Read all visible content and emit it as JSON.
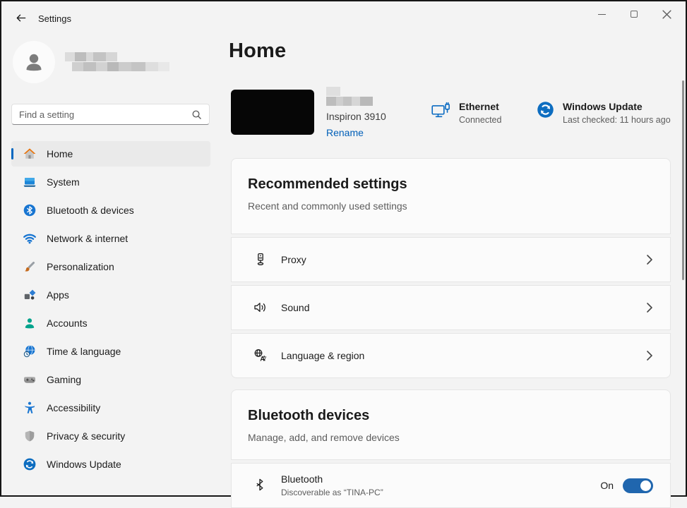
{
  "titlebar": {
    "title": "Settings"
  },
  "search": {
    "placeholder": "Find a setting"
  },
  "sidebar": {
    "items": [
      {
        "label": "Home",
        "icon": "home-icon",
        "selected": true
      },
      {
        "label": "System",
        "icon": "system-icon"
      },
      {
        "label": "Bluetooth & devices",
        "icon": "bluetooth-icon"
      },
      {
        "label": "Network & internet",
        "icon": "network-icon"
      },
      {
        "label": "Personalization",
        "icon": "personalization-icon"
      },
      {
        "label": "Apps",
        "icon": "apps-icon"
      },
      {
        "label": "Accounts",
        "icon": "accounts-icon"
      },
      {
        "label": "Time & language",
        "icon": "time-language-icon"
      },
      {
        "label": "Gaming",
        "icon": "gaming-icon"
      },
      {
        "label": "Accessibility",
        "icon": "accessibility-icon"
      },
      {
        "label": "Privacy & security",
        "icon": "privacy-icon"
      },
      {
        "label": "Windows Update",
        "icon": "windows-update-icon"
      }
    ]
  },
  "main": {
    "page_title": "Home",
    "device": {
      "model": "Inspiron 3910",
      "rename_label": "Rename"
    },
    "status": [
      {
        "title": "Ethernet",
        "subtitle": "Connected",
        "icon": "ethernet-icon"
      },
      {
        "title": "Windows Update",
        "subtitle": "Last checked: 11 hours ago",
        "icon": "windows-update-icon"
      }
    ],
    "groups": [
      {
        "title": "Recommended settings",
        "subtitle": "Recent and commonly used settings",
        "rows": [
          {
            "label": "Proxy",
            "icon": "proxy-icon"
          },
          {
            "label": "Sound",
            "icon": "sound-icon"
          },
          {
            "label": "Language & region",
            "icon": "language-region-icon"
          }
        ]
      },
      {
        "title": "Bluetooth devices",
        "subtitle": "Manage, add, and remove devices",
        "rows": [
          {
            "label": "Bluetooth",
            "sublabel": "Discoverable as “TINA-PC”",
            "icon": "bluetooth-glyph-icon",
            "toggle_label": "On",
            "toggle_state": true
          }
        ]
      }
    ]
  },
  "colors": {
    "accent": "#0067C0",
    "link": "#005FB8",
    "toggle_on": "#2066AE"
  }
}
